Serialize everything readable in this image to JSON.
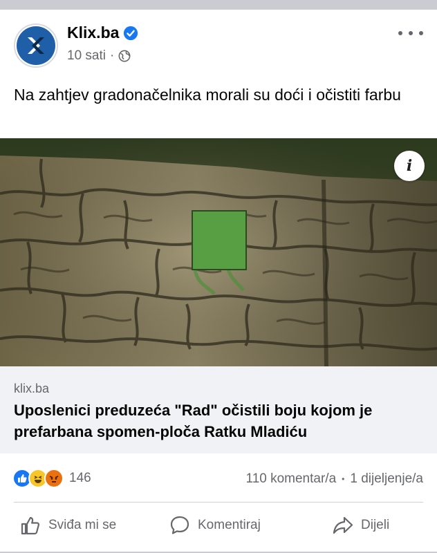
{
  "post": {
    "page_name": "Klix.ba",
    "verified": true,
    "time": "10 sati",
    "separator": "·",
    "privacy_icon": "globe-icon",
    "text": "Na zahtjev gradonačelnika morali su doći i očistiti farbu"
  },
  "link": {
    "domain": "klix.ba",
    "title": "Uposlenici preduzeća \"Rad\" očistili boju kojom je prefarbana spomen-ploča Ratku Mladiću",
    "info_icon_label": "i"
  },
  "stats": {
    "reactions": [
      "like",
      "haha",
      "angry"
    ],
    "reaction_count": "146",
    "comments": "110 komentar/a",
    "bullet": "•",
    "shares": "1 dijeljenje/a"
  },
  "actions": {
    "like": "Sviđa mi se",
    "comment": "Komentiraj",
    "share": "Dijeli"
  },
  "colors": {
    "brand_blue": "#1877f2",
    "klix_blue": "#1f5fa8",
    "secondary_text": "#65676b",
    "link_bg": "#f0f2f5"
  }
}
